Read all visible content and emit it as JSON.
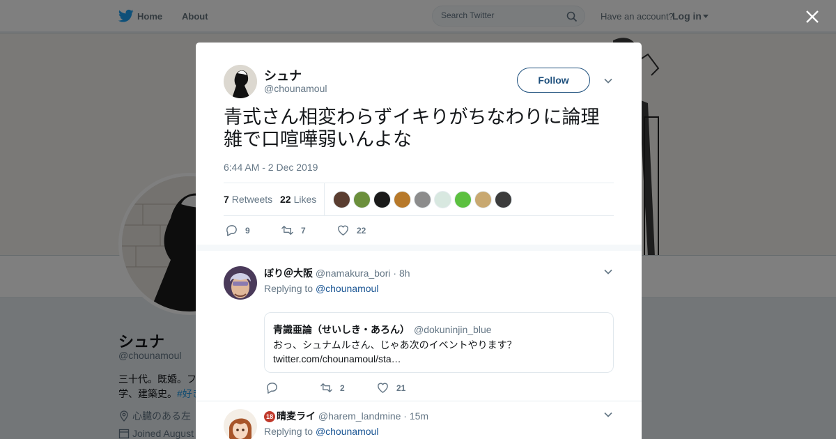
{
  "nav": {
    "home": "Home",
    "about": "About",
    "search_placeholder": "Search Twitter",
    "have_account": "Have an account?",
    "login": "Log in"
  },
  "profile": {
    "name": "シュナ",
    "handle": "@chounamoul",
    "bio_line1": "三十代。既婚。フ",
    "bio_line2": "学、建築史。",
    "bio_hashtag": "#好き",
    "location": "心臓のある左",
    "joined": "Joined August"
  },
  "tweet": {
    "author_name": "シュナ",
    "author_handle": "@chounamoul",
    "follow_label": "Follow",
    "text": "青式さん相変わらずイキりがちなわりに論理雑で口喧嘩弱いんよな",
    "timestamp": "6:44 AM - 2 Dec 2019",
    "retweets_count": "7",
    "retweets_label": "Retweets",
    "likes_count": "22",
    "likes_label": "Likes",
    "liker_colors": [
      "#5a3d30",
      "#6b8f3c",
      "#1a1a1a",
      "#b7792a",
      "#8c8c8c",
      "#d8e8e0",
      "#5cc040",
      "#c8a870",
      "#3c3c3c"
    ],
    "actions": {
      "reply": "9",
      "retweet": "7",
      "like": "22"
    }
  },
  "replies": [
    {
      "name": "ぼり＠大阪",
      "handle": "@namakura_bori",
      "time": "8h",
      "replying_to_label": "Replying to",
      "replying_to": "@chounamoul",
      "quote": {
        "name": "青識亜論（せいしき・あろん）",
        "handle": "@dokuninjin_blue",
        "text_line1": "おっ、シュナムルさん、じゃあ次のイベントやります？",
        "text_line2": "twitter.com/chounamoul/sta…"
      },
      "actions": {
        "reply": "",
        "retweet": "2",
        "like": "21"
      }
    },
    {
      "badge": "18",
      "name": "晴麦ライ",
      "handle": "@harem_landmine",
      "time": "15m",
      "replying_to_label": "Replying to",
      "replying_to": "@chounamoul"
    }
  ],
  "colors": {
    "link": "#1b5694",
    "follow": "#1d4f7c",
    "muted": "#657786"
  }
}
